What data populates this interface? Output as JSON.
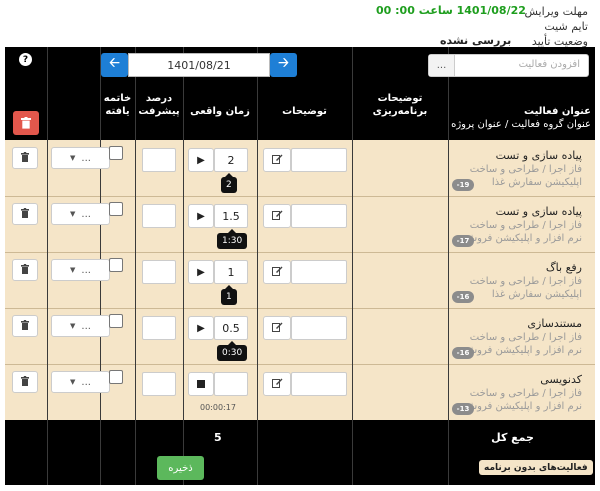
{
  "header": {
    "deadline_label": "مهلت ویرایش",
    "timesheet_label": "تایم شیت",
    "status_label": "وضعیت تأیید",
    "deadline_value": "1401/08/22 ساعت 00: 00",
    "status_value": "بررسی نشده"
  },
  "toolbar": {
    "date": "1401/08/21",
    "prev_icon": "arrow-left-icon",
    "next_icon": "arrow-right-icon",
    "help_icon": "question-icon",
    "add_activity_placeholder": "افزودن فعالیت",
    "add_activity_button": "..."
  },
  "columns": {
    "activity_title": "عنوان فعالیت",
    "activity_subtitle": "عنوان گروه فعالیت / عنوان پروژه",
    "planning_notes_1": "توضیحات",
    "planning_notes_2": "برنامه‌ریزی",
    "notes": "توضیحات",
    "actual_time": "زمان واقعی",
    "progress_1": "درصد",
    "progress_2": "پیشرفت",
    "done_1": "خاتمه",
    "done_2": "یافته"
  },
  "rows": [
    {
      "title": "پیاده سازی و تست",
      "group": "فاز اجرا / طراحی و ساخت",
      "project": "اپلیکیشن سفارش غذا",
      "badge": "-19",
      "time": "2",
      "tooltip": "2",
      "dropdown": "...",
      "running": false
    },
    {
      "title": "پیاده سازی و تست",
      "group": "فاز اجرا / طراحی و ساخت",
      "project": "نرم افزار و اپلیکیشن فروش",
      "badge": "-17",
      "time": "1.5",
      "tooltip": "1:30",
      "dropdown": "...",
      "running": false
    },
    {
      "title": "رفع باگ",
      "group": "فاز اجرا / طراحی و ساخت",
      "project": "اپلیکیشن سفارش غذا",
      "badge": "-16",
      "time": "1",
      "tooltip": "1",
      "dropdown": "...",
      "running": false
    },
    {
      "title": "مستندسازی",
      "group": "فاز اجرا / طراحی و ساخت",
      "project": "نرم افزار و اپلیکیشن فروش",
      "badge": "-16",
      "time": "0.5",
      "tooltip": "0:30",
      "dropdown": "...",
      "running": false
    },
    {
      "title": "کدنویسی",
      "group": "فاز اجرا / طراحی و ساخت",
      "project": "نرم افزار و اپلیکیشن فروش",
      "badge": "-13",
      "time": "",
      "timer": "00:00:17",
      "dropdown": "...",
      "running": true
    }
  ],
  "footer": {
    "total_label": "جمع کل",
    "total_value": "5",
    "save_label": "ذخیره",
    "unplanned_label": "فعالیت‌های بدون برنامه"
  },
  "colors": {
    "accent_blue": "#1e7fd6",
    "row_background": "#f5e5c8",
    "header_background": "#000000",
    "delete_red": "#e2574c",
    "save_green": "#5cb85c",
    "deadline_green": "#1e9e1e"
  }
}
